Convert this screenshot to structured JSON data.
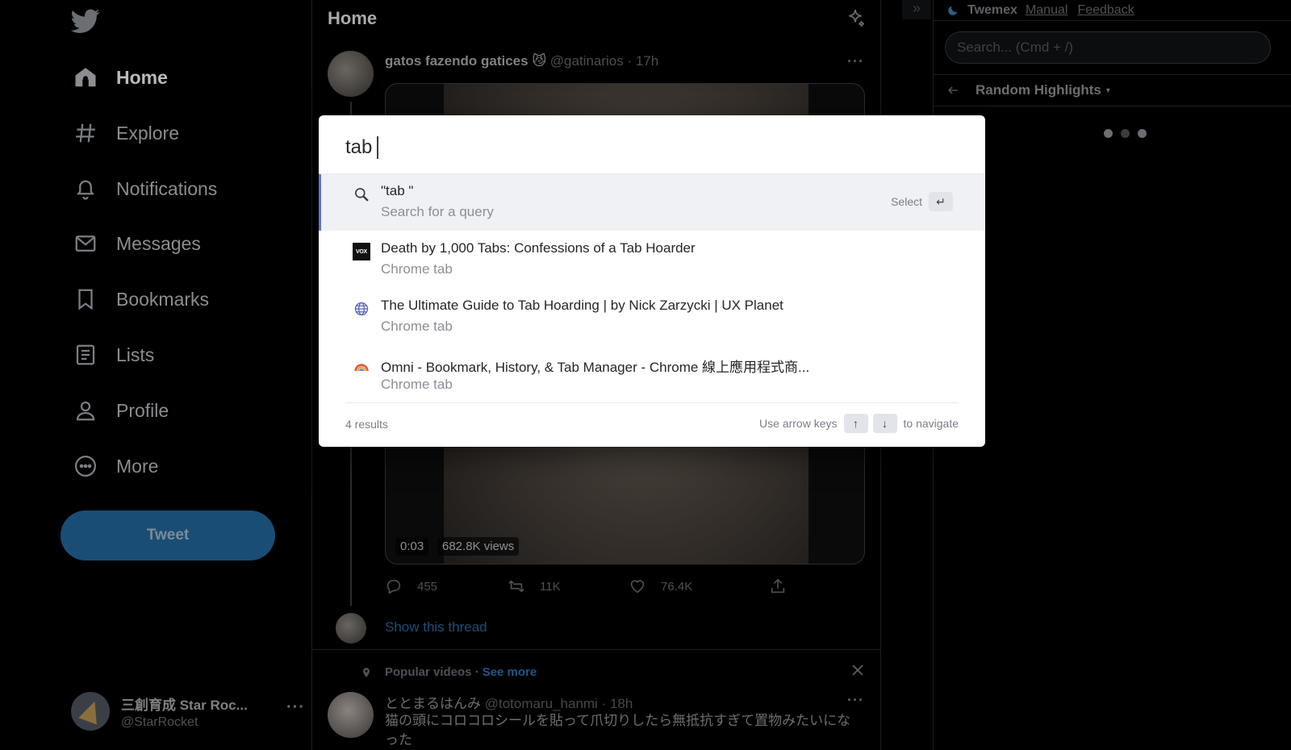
{
  "sidebar": {
    "items": [
      {
        "label": "Home",
        "icon": "home-icon",
        "active": true
      },
      {
        "label": "Explore",
        "icon": "hash-icon"
      },
      {
        "label": "Notifications",
        "icon": "bell-icon"
      },
      {
        "label": "Messages",
        "icon": "mail-icon"
      },
      {
        "label": "Bookmarks",
        "icon": "bookmark-icon"
      },
      {
        "label": "Lists",
        "icon": "list-icon"
      },
      {
        "label": "Profile",
        "icon": "person-icon"
      },
      {
        "label": "More",
        "icon": "more-circle-icon"
      }
    ],
    "tweet_button": "Tweet",
    "account": {
      "display_name": "三創育成 Star Roc...",
      "handle": "@StarRocket",
      "more": "···"
    }
  },
  "center": {
    "title": "Home",
    "tweet": {
      "name": "gatos fazendo gatices 😼",
      "handle": "@gatinarios · 17h",
      "more": "···",
      "duration": "0:03",
      "views": "682.8K views",
      "replies": "455",
      "retweets": "11K",
      "likes": "76.4K"
    },
    "show_thread": "Show this thread",
    "popular": {
      "label": "Popular videos ·",
      "see_more": "See more"
    },
    "tweet2": {
      "name": "ととまるはんみ",
      "handle": "@totomaru_hanmi · 18h",
      "more": "···",
      "text": "猫の頭にコロコロシールを貼って爪切りしたら無抵抗すぎて置物みたいになった"
    }
  },
  "right": {
    "collapse": "»",
    "twemex": {
      "title": "Twemex",
      "manual": "Manual",
      "feedback": "Feedback"
    },
    "search_placeholder": "Search... (Cmd + /)",
    "highlights": "Random Highlights",
    "highlights_caret": "▾"
  },
  "palette": {
    "query": "tab",
    "results": [
      {
        "title": "\"tab \"",
        "subtitle": "Search for a query",
        "icon": "search-icon",
        "selected": true,
        "hint": "Select",
        "hint_key": "↵"
      },
      {
        "title": "Death by 1,000 Tabs: Confessions of a Tab Hoarder",
        "subtitle": "Chrome tab",
        "icon": "vox-favicon",
        "favicon_text": "VOX"
      },
      {
        "title": "The Ultimate Guide to Tab Hoarding | by Nick Zarzycki | UX Planet",
        "subtitle": "Chrome tab",
        "icon": "globe-icon"
      },
      {
        "title": "Omni - Bookmark, History, & Tab Manager - Chrome 線上應用程式商...",
        "subtitle": "Chrome tab",
        "icon": "omni-icon"
      }
    ],
    "count": "4 results",
    "nav_prefix": "Use arrow keys",
    "nav_up": "↑",
    "nav_down": "↓",
    "nav_suffix": "to navigate"
  },
  "colors": {
    "accent": "#6473c8",
    "tweet_button": "#1a4d75",
    "link": "#1d5687"
  }
}
